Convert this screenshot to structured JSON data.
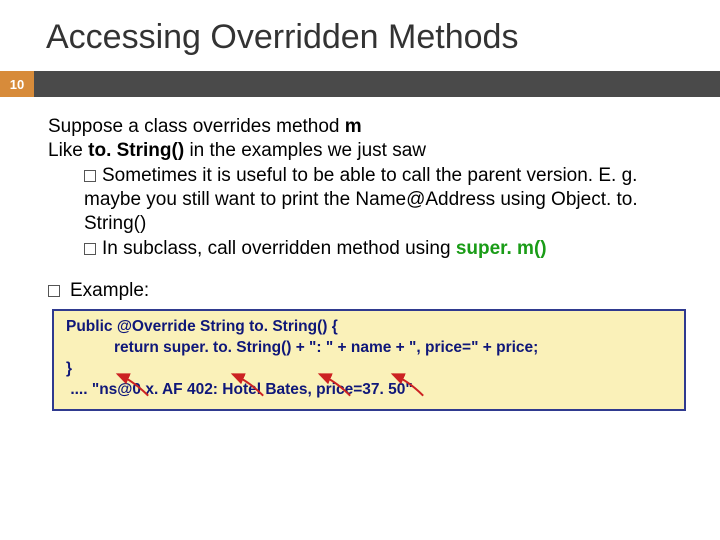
{
  "title": "Accessing Overridden Methods",
  "pageNumber": "10",
  "body": {
    "p1a": "Suppose a class overrides method ",
    "p1b": "m",
    "p2a": "Like ",
    "p2b": "to. String()",
    "p2c": " in the examples we just saw",
    "b1": "Sometimes it is useful to be able to call the parent version.  E. g. maybe you still want to print the Name@Address using Object. to. String()",
    "b2a": "In subclass, call overridden method using ",
    "b2b": "super. m()",
    "exLabel": "Example:"
  },
  "code": {
    "l1": "Public @Override String to. String() {",
    "l2": "return super. to. String() + \": \" + name + \", price=\" + price;",
    "l3": "}",
    "l4": ".... \"ns@0 x. AF 402: Hotel Bates, price=37. 50\""
  }
}
